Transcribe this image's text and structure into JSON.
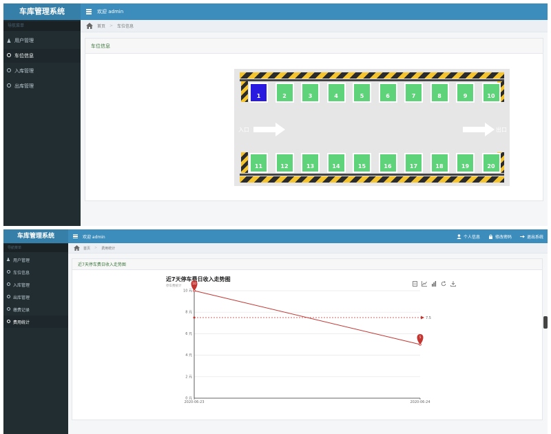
{
  "app": {
    "title": "车库管理系统",
    "welcome": "欢迎 admin"
  },
  "screen1": {
    "sidebar": {
      "header": "导航菜单",
      "items": [
        {
          "label": "用户管理",
          "icon": "user-icon"
        },
        {
          "label": "车位信息",
          "icon": "circle-icon",
          "active": true
        },
        {
          "label": "入库管理",
          "icon": "circle-icon"
        },
        {
          "label": "出库管理",
          "icon": "circle-icon"
        }
      ]
    },
    "breadcrumb": {
      "home": "首页",
      "current": "车位信息"
    },
    "panel_title": "车位信息",
    "parking": {
      "entrance": "入口",
      "exit": "出口",
      "top_row": [
        {
          "number": "1",
          "occupied": true
        },
        {
          "number": "2",
          "occupied": false
        },
        {
          "number": "3",
          "occupied": false
        },
        {
          "number": "4",
          "occupied": false
        },
        {
          "number": "5",
          "occupied": false
        },
        {
          "number": "6",
          "occupied": false
        },
        {
          "number": "7",
          "occupied": false
        },
        {
          "number": "8",
          "occupied": false
        },
        {
          "number": "9",
          "occupied": false
        },
        {
          "number": "10",
          "occupied": false
        }
      ],
      "bottom_row": [
        {
          "number": "11",
          "occupied": false
        },
        {
          "number": "12",
          "occupied": false
        },
        {
          "number": "13",
          "occupied": false
        },
        {
          "number": "14",
          "occupied": false
        },
        {
          "number": "15",
          "occupied": false
        },
        {
          "number": "16",
          "occupied": false
        },
        {
          "number": "17",
          "occupied": false
        },
        {
          "number": "18",
          "occupied": false
        },
        {
          "number": "19",
          "occupied": false
        },
        {
          "number": "20",
          "occupied": false
        }
      ],
      "colors": {
        "free": "#5fd37a",
        "occupied": "#2a1ae0"
      }
    }
  },
  "screen2": {
    "top_links": [
      "个人信息",
      "修改密码",
      "退出系统"
    ],
    "sidebar": {
      "header": "导航菜单",
      "items": [
        {
          "label": "用户管理",
          "icon": "user-icon"
        },
        {
          "label": "车位信息",
          "icon": "circle-icon"
        },
        {
          "label": "入库管理",
          "icon": "circle-icon"
        },
        {
          "label": "出库管理",
          "icon": "circle-icon"
        },
        {
          "label": "缴费记录",
          "icon": "circle-icon"
        },
        {
          "label": "费用统计",
          "icon": "circle-icon",
          "active": true
        }
      ]
    },
    "breadcrumb": {
      "home": "首页",
      "current": "费用统计"
    },
    "panel_title": "近7天停车费日收入走势图"
  },
  "chart_data": {
    "type": "line",
    "title": "近7天停车费日收入走势图",
    "subtitle": "停车费统计",
    "x": [
      "2020-06-23",
      "2020-06-24"
    ],
    "series": [
      {
        "values": [
          10,
          5
        ],
        "color": "#c23531"
      }
    ],
    "max_point_label": "10",
    "min_point_label": "5",
    "average": 7.5,
    "average_label": "7.5",
    "ylim": [
      0,
      10
    ],
    "yticks": [
      0,
      2,
      4,
      6,
      8,
      10
    ],
    "ytick_labels": [
      "0 元",
      "2 元",
      "4 元",
      "6 元",
      "8 元",
      "10 元"
    ],
    "grid": true,
    "toolbox": [
      "data-view-icon",
      "line-chart-icon",
      "bar-chart-icon",
      "restore-icon",
      "save-image-icon"
    ]
  }
}
